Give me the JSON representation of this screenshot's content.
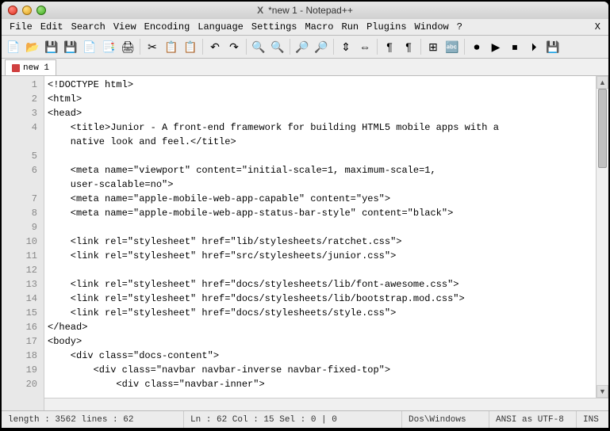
{
  "window": {
    "title": "*new  1 - Notepad++"
  },
  "menus": [
    "File",
    "Edit",
    "Search",
    "View",
    "Encoding",
    "Language",
    "Settings",
    "Macro",
    "Run",
    "Plugins",
    "Window",
    "?"
  ],
  "toolbar_icons": [
    {
      "name": "new-file-icon",
      "glyph": "📄"
    },
    {
      "name": "open-file-icon",
      "glyph": "📂"
    },
    {
      "name": "save-icon",
      "glyph": "💾"
    },
    {
      "name": "save-all-icon",
      "glyph": "💾"
    },
    {
      "name": "close-icon",
      "glyph": "📄"
    },
    {
      "name": "close-all-icon",
      "glyph": "📑"
    },
    {
      "name": "print-icon",
      "glyph": "🖨"
    },
    {
      "sep": true
    },
    {
      "name": "cut-icon",
      "glyph": "✂"
    },
    {
      "name": "copy-icon",
      "glyph": "📋"
    },
    {
      "name": "paste-icon",
      "glyph": "📋"
    },
    {
      "sep": true
    },
    {
      "name": "undo-icon",
      "glyph": "↶"
    },
    {
      "name": "redo-icon",
      "glyph": "↷"
    },
    {
      "sep": true
    },
    {
      "name": "find-icon",
      "glyph": "🔍"
    },
    {
      "name": "replace-icon",
      "glyph": "🔍"
    },
    {
      "sep": true
    },
    {
      "name": "zoom-in-icon",
      "glyph": "🔎"
    },
    {
      "name": "zoom-out-icon",
      "glyph": "🔎"
    },
    {
      "sep": true
    },
    {
      "name": "sync-v-icon",
      "glyph": "⇕"
    },
    {
      "name": "sync-h-icon",
      "glyph": "⇔"
    },
    {
      "sep": true
    },
    {
      "name": "wrap-icon",
      "glyph": "¶"
    },
    {
      "name": "all-chars-icon",
      "glyph": "¶"
    },
    {
      "sep": true
    },
    {
      "name": "indent-guide-icon",
      "glyph": "⊞"
    },
    {
      "name": "language-icon",
      "glyph": "🔤"
    },
    {
      "sep": true
    },
    {
      "name": "record-icon",
      "glyph": "⏺"
    },
    {
      "name": "play-icon",
      "glyph": "▶"
    },
    {
      "name": "stop-icon",
      "glyph": "⏹"
    },
    {
      "name": "playback-icon",
      "glyph": "⏵"
    },
    {
      "name": "save-macro-icon",
      "glyph": "💾"
    }
  ],
  "tab": {
    "label": "new  1"
  },
  "status": {
    "length": "length : 3562    lines : 62",
    "pos": "Ln : 62    Col : 15    Sel : 0 | 0",
    "eol": "Dos\\Windows",
    "enc": "ANSI as UTF-8",
    "mode": "INS"
  },
  "code_lines": [
    {
      "n": 1,
      "t": "<!DOCTYPE html>"
    },
    {
      "n": 2,
      "t": "<html>"
    },
    {
      "n": 3,
      "t": "<head>"
    },
    {
      "n": 4,
      "t": "    <title>Junior - A front-end framework for building HTML5 mobile apps with a"
    },
    {
      "n": 0,
      "t": "    native look and feel.</title>"
    },
    {
      "n": 5,
      "t": ""
    },
    {
      "n": 6,
      "t": "    <meta name=\"viewport\" content=\"initial-scale=1, maximum-scale=1,"
    },
    {
      "n": 0,
      "t": "    user-scalable=no\">"
    },
    {
      "n": 7,
      "t": "    <meta name=\"apple-mobile-web-app-capable\" content=\"yes\">"
    },
    {
      "n": 8,
      "t": "    <meta name=\"apple-mobile-web-app-status-bar-style\" content=\"black\">"
    },
    {
      "n": 9,
      "t": ""
    },
    {
      "n": 10,
      "t": "    <link rel=\"stylesheet\" href=\"lib/stylesheets/ratchet.css\">"
    },
    {
      "n": 11,
      "t": "    <link rel=\"stylesheet\" href=\"src/stylesheets/junior.css\">"
    },
    {
      "n": 12,
      "t": ""
    },
    {
      "n": 13,
      "t": "    <link rel=\"stylesheet\" href=\"docs/stylesheets/lib/font-awesome.css\">"
    },
    {
      "n": 14,
      "t": "    <link rel=\"stylesheet\" href=\"docs/stylesheets/lib/bootstrap.mod.css\">"
    },
    {
      "n": 15,
      "t": "    <link rel=\"stylesheet\" href=\"docs/stylesheets/style.css\">"
    },
    {
      "n": 16,
      "t": "</head>"
    },
    {
      "n": 17,
      "t": "<body>"
    },
    {
      "n": 18,
      "t": "    <div class=\"docs-content\">"
    },
    {
      "n": 19,
      "t": "        <div class=\"navbar navbar-inverse navbar-fixed-top\">"
    },
    {
      "n": 20,
      "t": "            <div class=\"navbar-inner\">"
    }
  ]
}
